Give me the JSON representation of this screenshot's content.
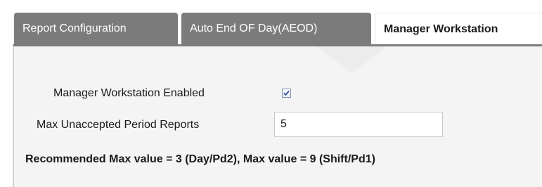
{
  "tabs": [
    {
      "label": "Report Configuration",
      "active": false
    },
    {
      "label": "Auto End OF Day(AEOD)",
      "active": false
    },
    {
      "label": "Manager Workstation",
      "active": true
    }
  ],
  "form": {
    "enabled_label": "Manager Workstation Enabled",
    "enabled_checked": true,
    "max_reports_label": "Max Unaccepted Period Reports",
    "max_reports_value": "5",
    "recommendation": "Recommended Max value = 3 (Day/Pd2), Max value = 9 (Shift/Pd1)"
  },
  "colors": {
    "tab_inactive": "#7b7b7b",
    "panel_bg": "#f4f4f4",
    "check_mark": "#2f4f9f"
  }
}
